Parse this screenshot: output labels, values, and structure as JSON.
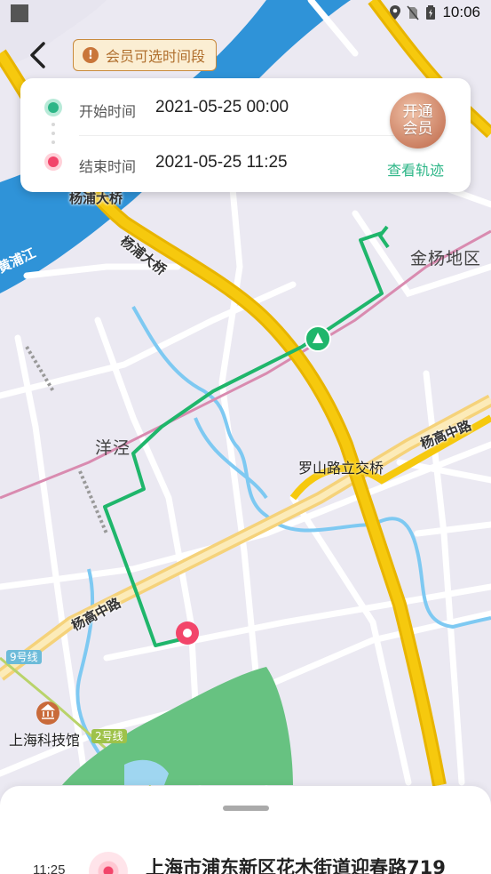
{
  "status_bar": {
    "time": "10:06",
    "icons": [
      "location-icon",
      "no-sim-icon",
      "battery-icon"
    ]
  },
  "header": {
    "vip_badge_icon": "!",
    "vip_badge_text": "会员可选时间段"
  },
  "time_card": {
    "start_label": "开始时间",
    "start_value": "2021-05-25 00:00",
    "end_label": "结束时间",
    "end_value": "2021-05-25 11:25",
    "open_vip_line1": "开通",
    "open_vip_line2": "会员",
    "view_track": "查看轨迹"
  },
  "map": {
    "labels": {
      "yangpu_bridge_1": "杨浦大桥",
      "yangpu_bridge_2": "杨浦大桥",
      "jinyang": "金杨地区",
      "yangjing": "洋泾",
      "luoshan": "罗山路立交桥",
      "yanggao_1": "杨高中路",
      "yanggao_2": "杨高中路",
      "museum": "上海科技馆",
      "huangpu": "黄浦江"
    },
    "metro": {
      "line9": "9号线",
      "line2": "2号线"
    },
    "colors": {
      "track": "#1fb66b",
      "water": "#a3d3f5",
      "river": "#2f93d8",
      "highway": "#f6c90e",
      "park": "#67c281"
    }
  },
  "bottom_sheet": {
    "item_time": "11:25",
    "item_address": "上海市浦东新区花木街道迎春路719"
  }
}
